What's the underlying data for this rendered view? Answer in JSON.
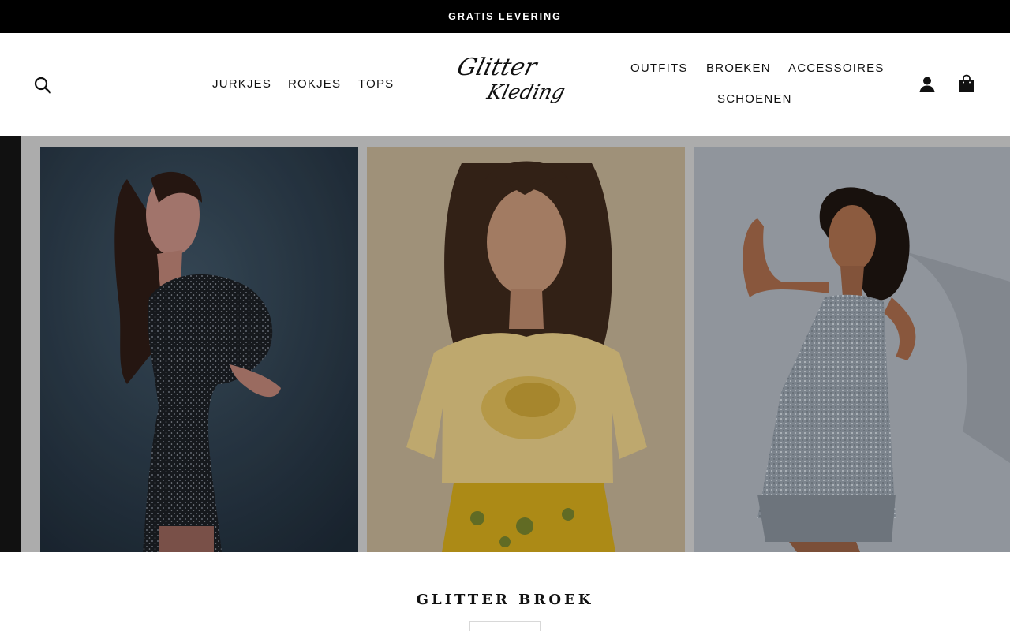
{
  "announcement": {
    "text": "GRATIS LEVERING"
  },
  "header": {
    "logo": {
      "line1": "Glitter",
      "line2": "Kleding"
    },
    "nav_left": [
      "JURKJES",
      "ROKJES",
      "TOPS"
    ],
    "nav_right": [
      "OUTFITS",
      "BROEKEN",
      "ACCESSOIRES",
      "SCHOENEN"
    ],
    "icons": {
      "search": "search-icon",
      "account": "user-icon",
      "cart": "shopping-bag-icon"
    }
  },
  "hero": {
    "images": [
      {
        "name": "model-black-sequin-dress"
      },
      {
        "name": "model-yellow-glitter-tshirt"
      },
      {
        "name": "model-silver-fringe-dress"
      }
    ]
  },
  "section": {
    "title": "GLITTER BROEK",
    "button_label": ""
  },
  "colors": {
    "announcement_bg": "#000000",
    "text": "#111111",
    "hero_bg": "#c4c4c4"
  }
}
